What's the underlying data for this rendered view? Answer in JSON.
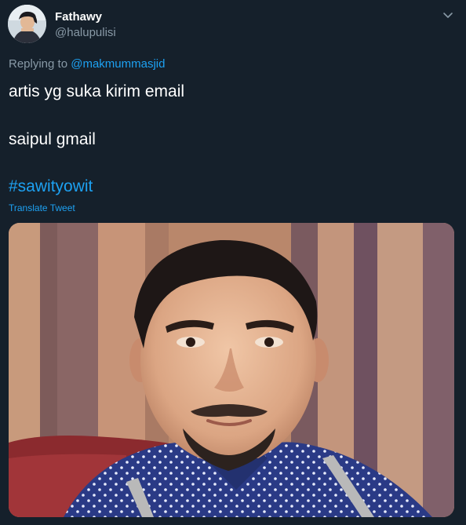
{
  "author": {
    "display_name": "Fathawy",
    "handle": "@halupulisi",
    "avatar_icon": "profile-avatar"
  },
  "menu_icon": "chevron-down-icon",
  "reply": {
    "prefix": "Replying to ",
    "mention": "@makmummasjid"
  },
  "tweet": {
    "line1": "artis yg suka kirim email",
    "line2": "saipul gmail",
    "hashtag": "#sawityowit",
    "translate_label": "Translate Tweet"
  },
  "media": {
    "icon": "photo-of-man"
  },
  "colors": {
    "background": "#15202b",
    "text_primary": "#ffffff",
    "text_secondary": "#8899a6",
    "accent": "#1da1f2"
  }
}
